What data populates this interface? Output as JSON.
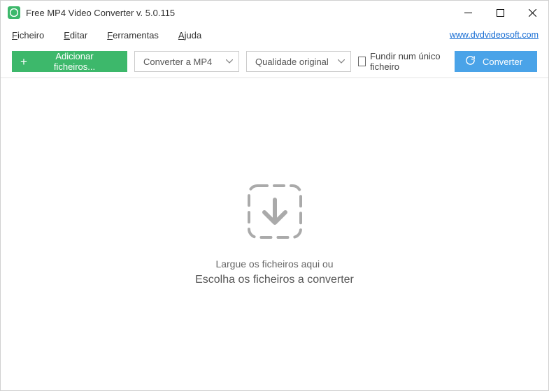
{
  "title": "Free MP4 Video Converter v. 5.0.115",
  "menu": {
    "ficheiro": "Ficheiro",
    "editar": "Editar",
    "ferramentas": "Ferramentas",
    "ajuda": "Ajuda"
  },
  "link": "www.dvdvideosoft.com",
  "toolbar": {
    "add_files": "Adicionar ficheiros...",
    "format": "Converter a MP4",
    "quality": "Qualidade original",
    "merge": "Fundir num único ficheiro",
    "convert": "Converter"
  },
  "dropzone": {
    "line1": "Largue os ficheiros aqui ou",
    "line2": "Escolha os ficheiros a converter"
  }
}
